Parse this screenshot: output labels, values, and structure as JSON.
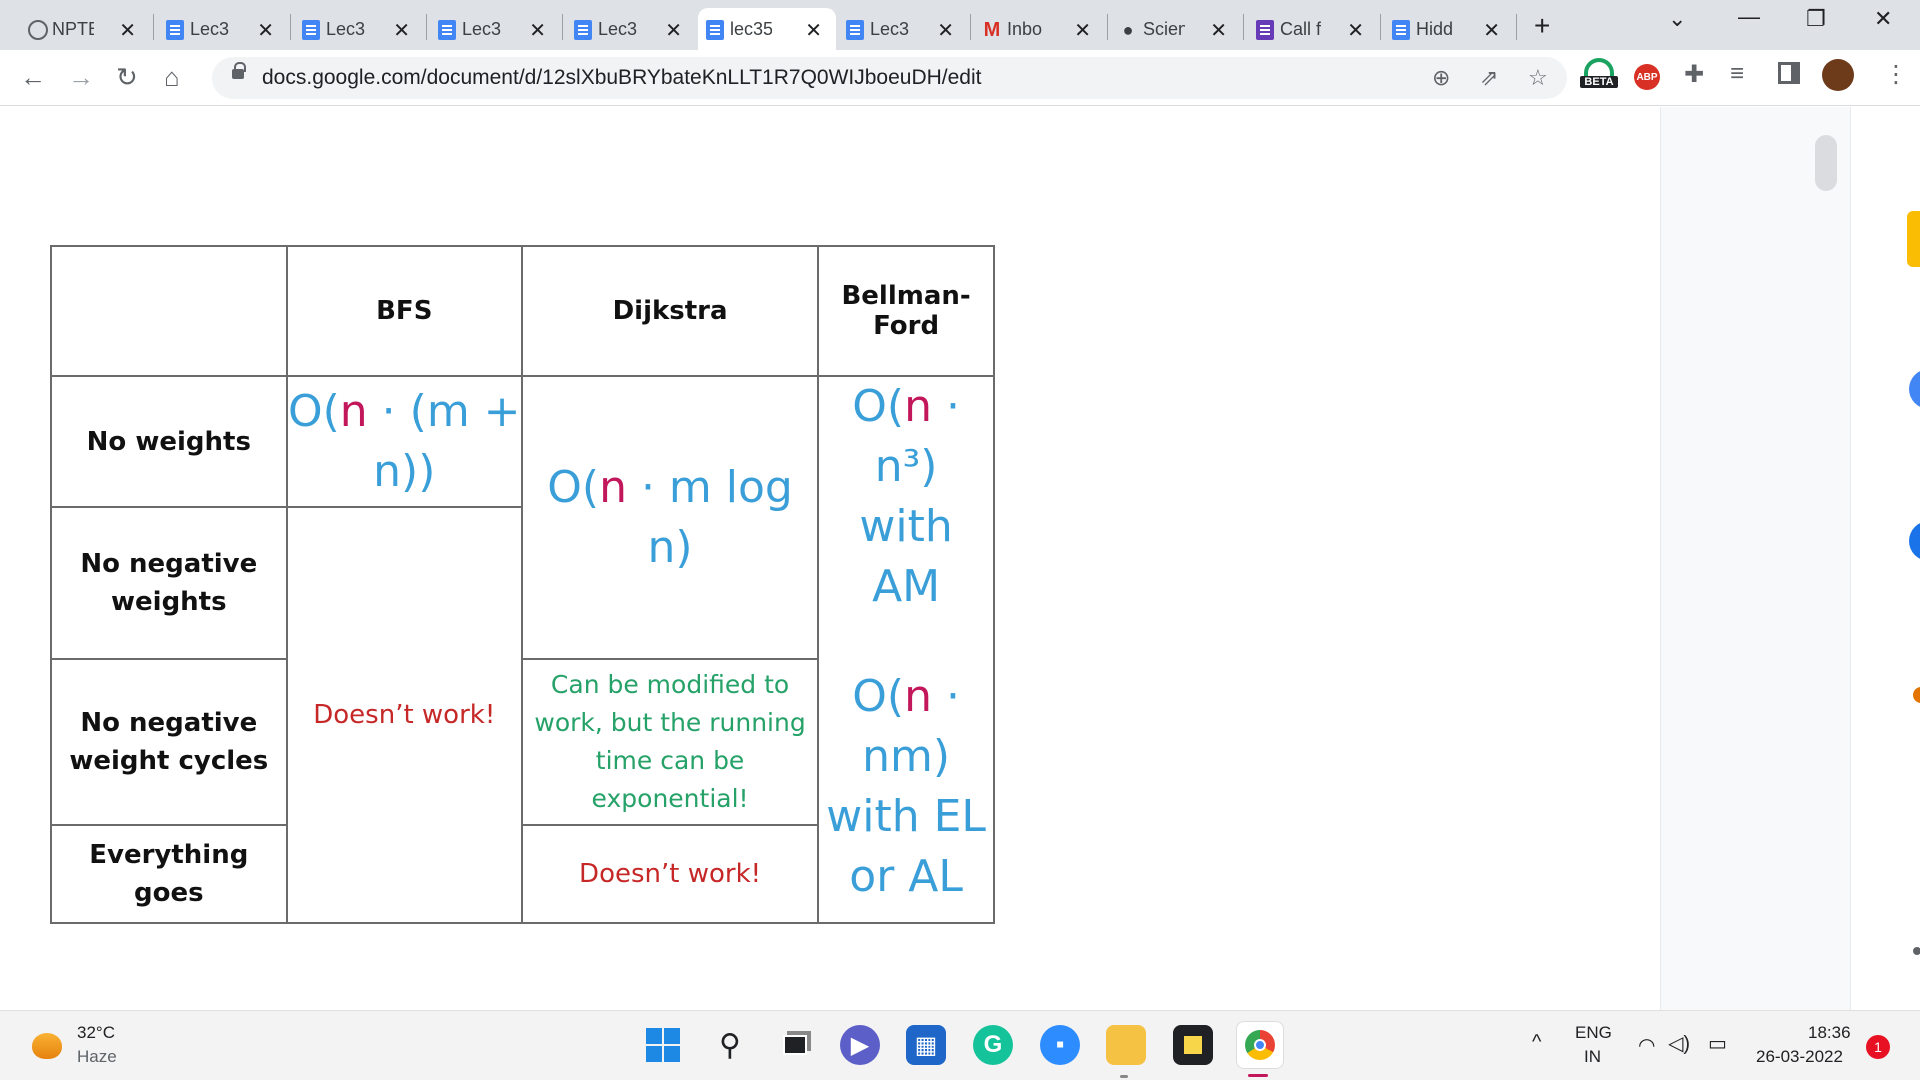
{
  "tabs": [
    {
      "title": "NPTE",
      "favicon": "globe-icon"
    },
    {
      "title": "Lec3",
      "favicon": "docs-icon"
    },
    {
      "title": "Lec3",
      "favicon": "docs-icon"
    },
    {
      "title": "Lec3",
      "favicon": "docs-icon"
    },
    {
      "title": "Lec3",
      "favicon": "docs-icon"
    },
    {
      "title": "lec35",
      "favicon": "docs-icon",
      "active": true
    },
    {
      "title": "Lec3",
      "favicon": "docs-icon"
    },
    {
      "title": "Inbo",
      "favicon": "gmail-icon"
    },
    {
      "title": "Scien",
      "favicon": "chat-icon"
    },
    {
      "title": "Call f",
      "favicon": "forms-icon"
    },
    {
      "title": "Hidd",
      "favicon": "docs-icon"
    }
  ],
  "toolbar": {
    "url": "docs.google.com/document/d/12slXbuBRYbateKnLLT1R7Q0WIJboeuDH/edit",
    "beta_label": "BETA",
    "abp_label": "ABP"
  },
  "table": {
    "headers": [
      "",
      "BFS",
      "Dijkstra",
      "Bellman-Ford"
    ],
    "row_labels": [
      "No weights",
      "No negative weights",
      "No negative weight cycles",
      "Everything goes"
    ],
    "bfs_no_weights": {
      "prefix": "O(",
      "n": "n",
      "suffix": " · (m + n))"
    },
    "dijkstra_complexity": {
      "prefix": "O(",
      "n": "n",
      "suffix": " · m log n)"
    },
    "bf_am": {
      "prefix": "O(",
      "n": "n",
      "suffix": " · n³)",
      "line2": "with AM"
    },
    "bf_el": {
      "prefix": "O(",
      "n": "n",
      "suffix": " · nm)",
      "line2": "with EL",
      "line3": "or AL"
    },
    "bfs_other": "Doesn’t work!",
    "dijkstra_modified": "Can be modified to work, but the running time can be exponential!",
    "dijkstra_everything": "Doesn’t work!"
  },
  "taskbar": {
    "weather_temp": "32°C",
    "weather_desc": "Haze",
    "lang_top": "ENG",
    "lang_bottom": "IN",
    "time": "18:36",
    "date": "26-03-2022",
    "notification_count": "1"
  },
  "colors": {
    "complexity": "#3a9fd8",
    "n_highlight": "#c2185b",
    "fail": "#c62828",
    "modified": "#26a269"
  }
}
